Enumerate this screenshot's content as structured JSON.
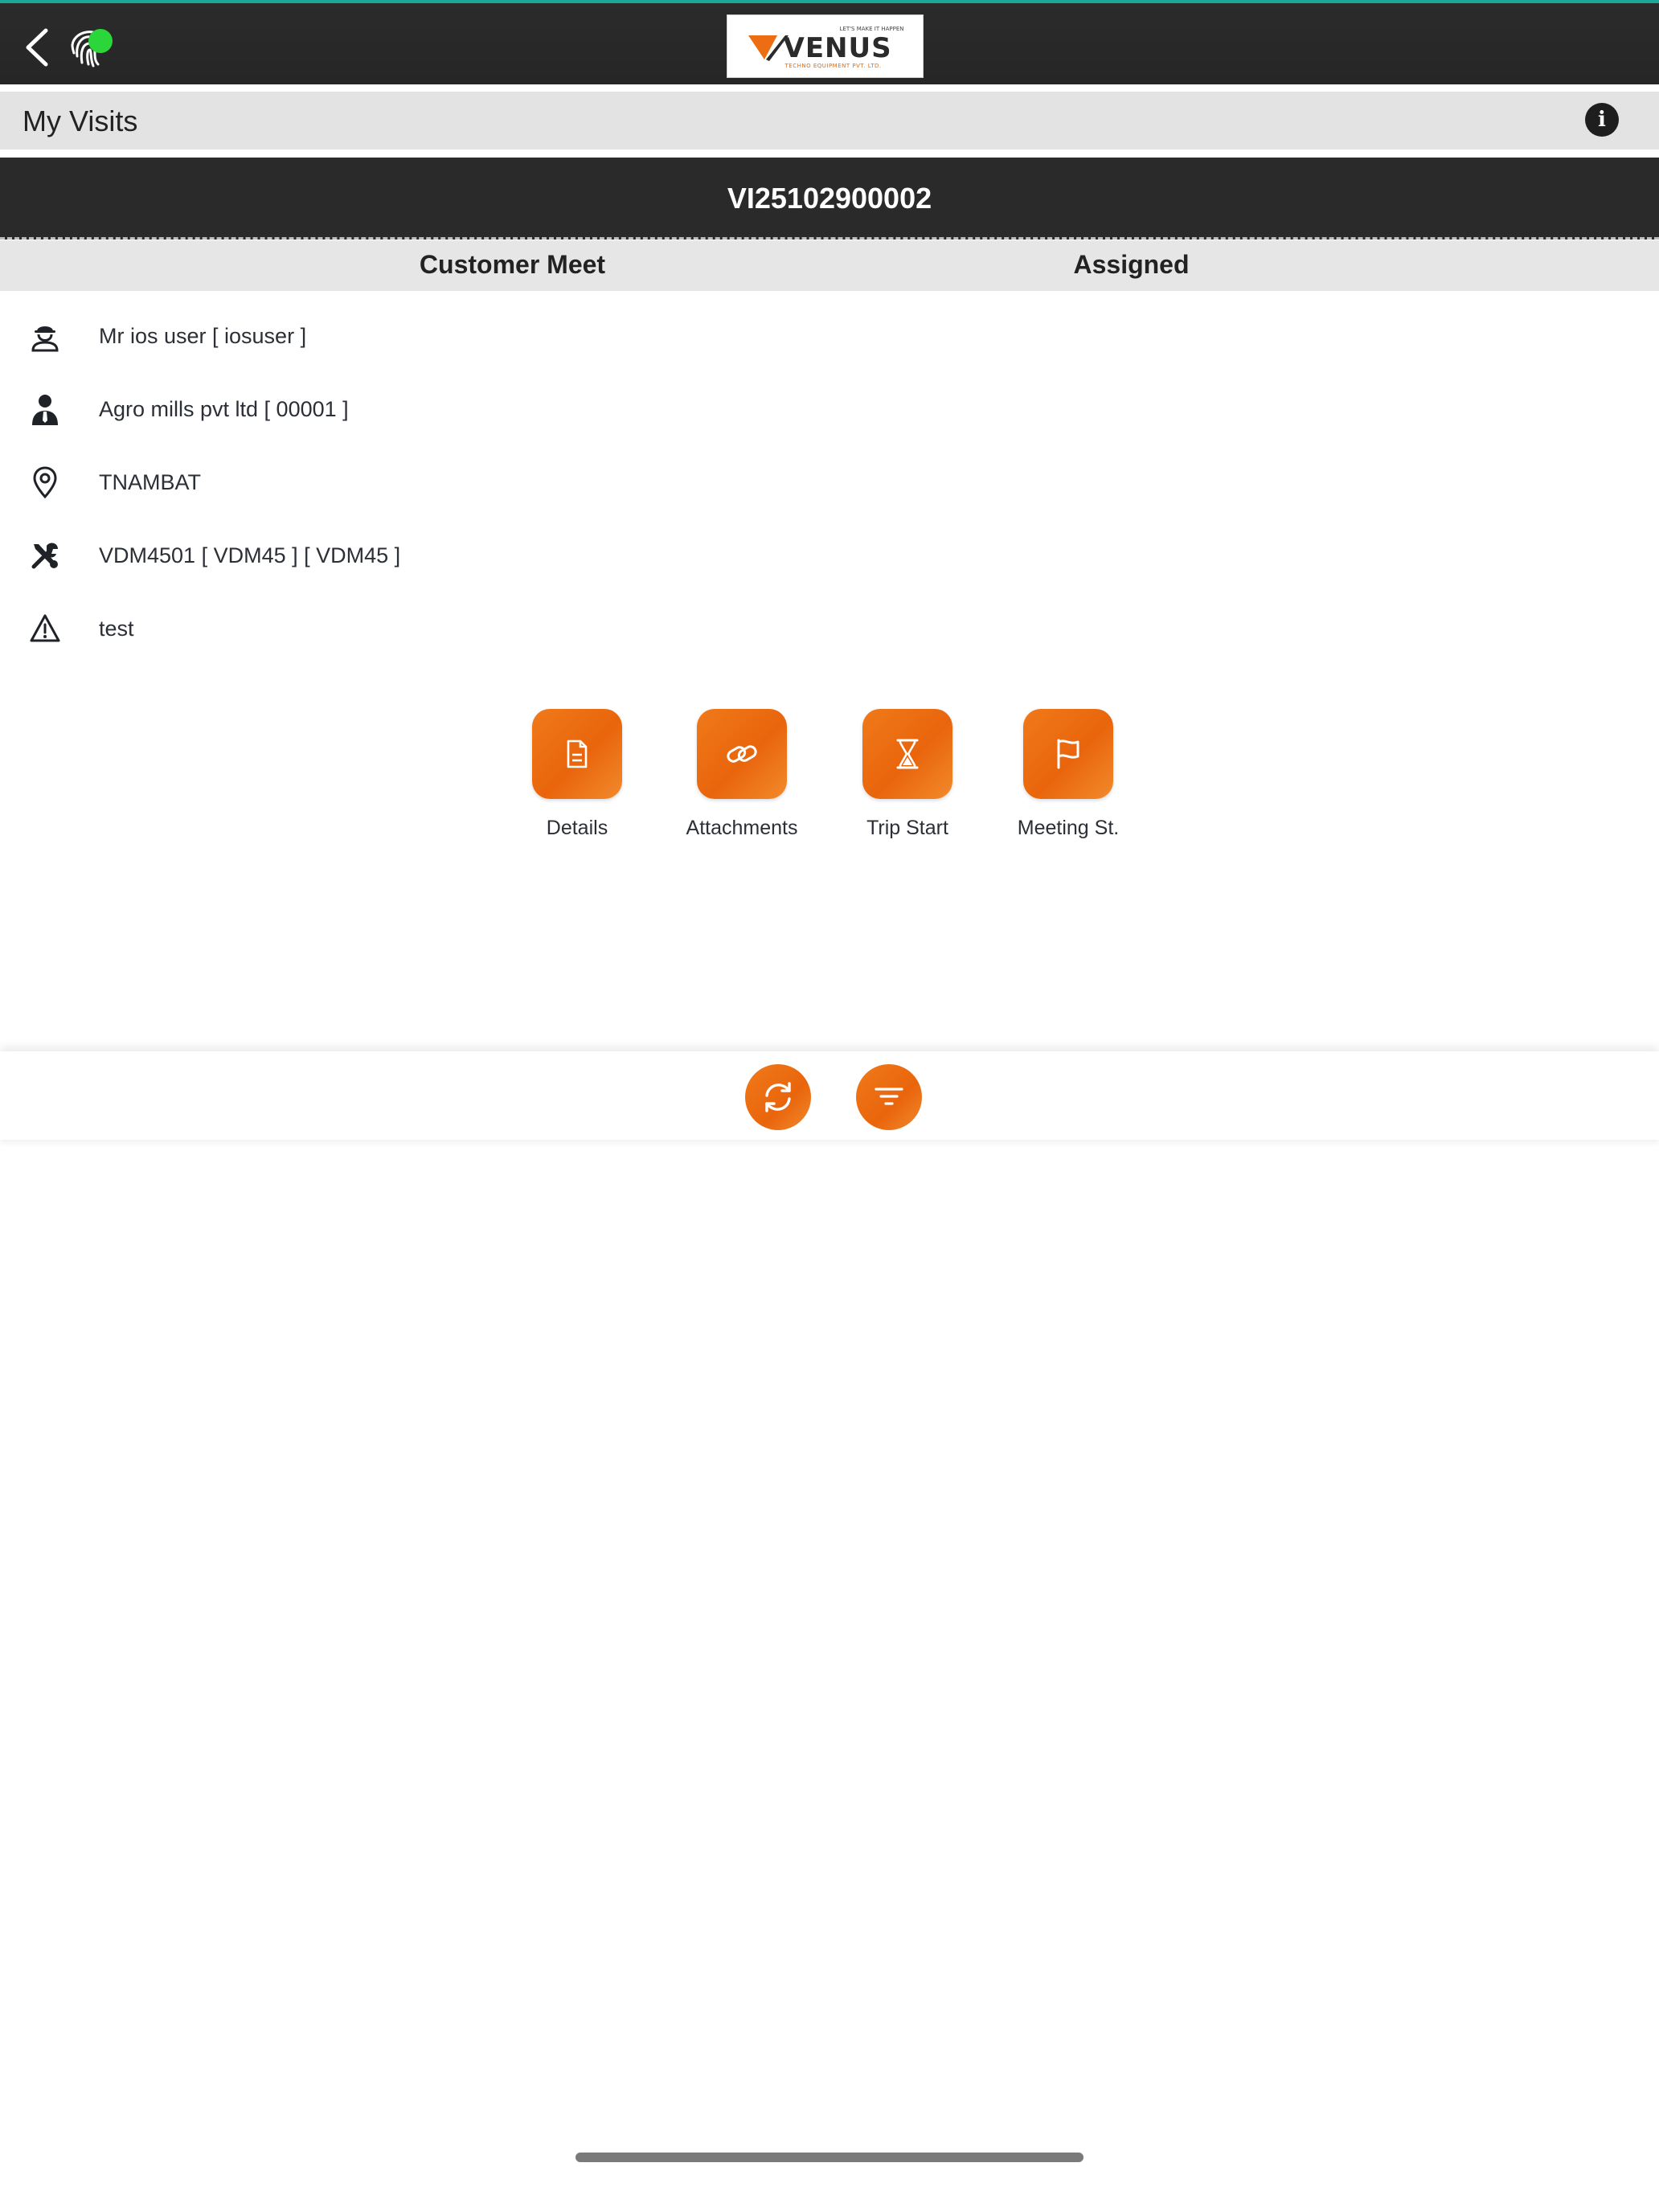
{
  "header": {
    "back_icon": "chevron-left-icon",
    "fingerprint_icon": "fingerprint-icon",
    "status_color": "#2bd63b",
    "logo": {
      "word": "VENUS",
      "tagline": "LET'S MAKE IT HAPPEN",
      "subtitle": "TECHNO EQUIPMENT PVT. LTD."
    }
  },
  "titlebar": {
    "title": "My Visits",
    "info_icon": "info-icon"
  },
  "visit": {
    "id": "VI25102900002",
    "type": "Customer Meet",
    "status": "Assigned"
  },
  "details": [
    {
      "icon": "engineer-icon",
      "text": "Mr ios user [ iosuser ]"
    },
    {
      "icon": "customer-icon",
      "text": "Agro mills pvt ltd [ 00001 ]"
    },
    {
      "icon": "location-pin-icon",
      "text": "TNAMBAT"
    },
    {
      "icon": "tools-icon",
      "text": "VDM4501 [ VDM45 ] [ VDM45 ]"
    },
    {
      "icon": "warning-icon",
      "text": "test"
    }
  ],
  "actions": [
    {
      "icon": "document-icon",
      "label": "Details"
    },
    {
      "icon": "link-icon",
      "label": "Attachments"
    },
    {
      "icon": "hourglass-icon",
      "label": "Trip Start"
    },
    {
      "icon": "flag-icon",
      "label": "Meeting St."
    }
  ],
  "toolbar": {
    "refresh_icon": "refresh-icon",
    "filter_icon": "filter-icon"
  },
  "colors": {
    "accent": "#ec6d12",
    "header_bg": "#2a2a2a",
    "subheader_bg": "#e3e3e3"
  }
}
